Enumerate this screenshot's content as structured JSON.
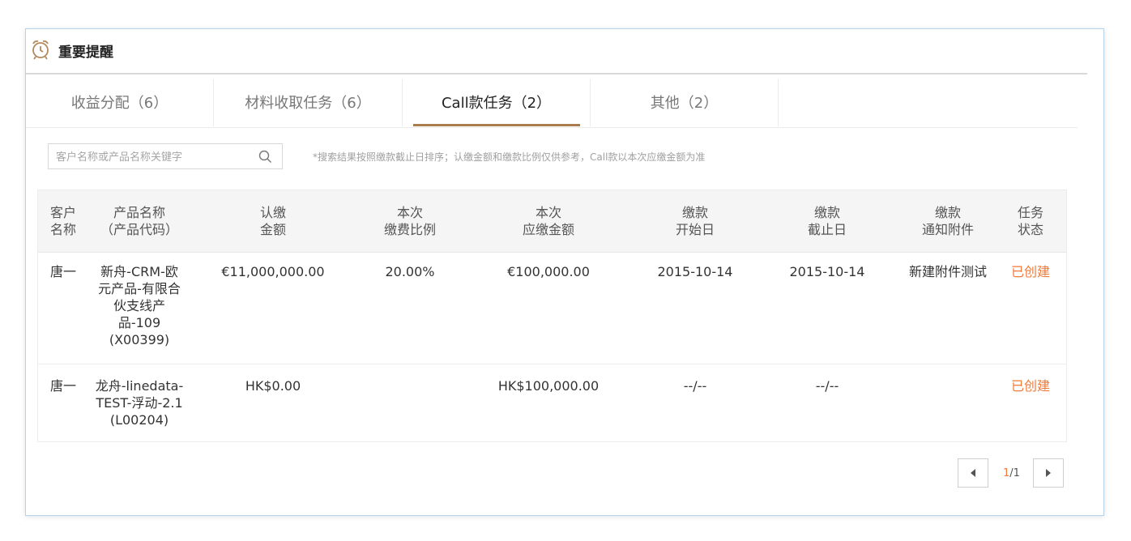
{
  "header": {
    "title": "重要提醒",
    "icon": "alarm-clock-icon"
  },
  "tabs": [
    {
      "label": "收益分配（6）",
      "active": false
    },
    {
      "label": "材料收取任务（6）",
      "active": false
    },
    {
      "label": "Call款任务（2）",
      "active": true
    },
    {
      "label": "其他（2）",
      "active": false
    }
  ],
  "search": {
    "placeholder": "客户名称或产品名称关键字",
    "value": "",
    "hint": "*搜索结果按照缴款截止日排序；认缴金额和缴款比例仅供参考，Call款以本次应缴金额为准"
  },
  "table": {
    "columns": [
      [
        "客户",
        "名称"
      ],
      [
        "产品名称",
        "（产品代码）"
      ],
      [
        "认缴",
        "金额"
      ],
      [
        "本次",
        "缴费比例"
      ],
      [
        "本次",
        "应缴金额"
      ],
      [
        "缴款",
        "开始日"
      ],
      [
        "缴款",
        "截止日"
      ],
      [
        "缴款",
        "通知附件"
      ],
      [
        "任务",
        "状态"
      ]
    ],
    "rows": [
      {
        "customer": "唐一",
        "product": [
          "新舟-CRM-欧",
          "元产品-有限合",
          "伙支线产",
          "品-109",
          "(X00399)"
        ],
        "subscribed": "€11,000,000.00",
        "ratio": "20.00%",
        "payable": "€100,000.00",
        "start": "2015-10-14",
        "end": "2015-10-14",
        "attachment": "新建附件测试",
        "status": "已创建"
      },
      {
        "customer": "唐一",
        "product": [
          "龙舟-linedata-",
          "TEST-浮动-2.1",
          "(L00204)"
        ],
        "subscribed": "HK$0.00",
        "ratio": "",
        "payable": "HK$100,000.00",
        "start": "--/--",
        "end": "--/--",
        "attachment": "",
        "status": "已创建"
      }
    ]
  },
  "pagination": {
    "current": "1",
    "separator": "/",
    "total": "1"
  },
  "colors": {
    "accent": "#a97c4d",
    "status": "#f07a3a",
    "border": "#b7d3ea"
  }
}
